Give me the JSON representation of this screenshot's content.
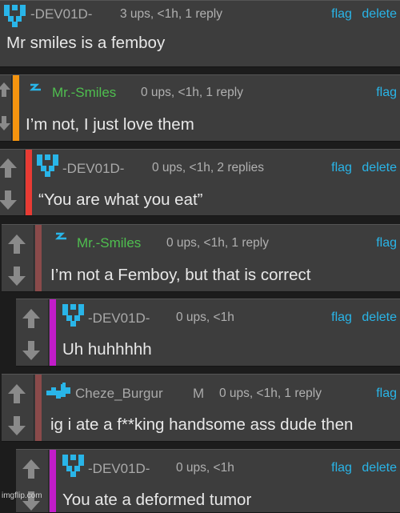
{
  "colors": {
    "accent_link": "#29b5e8",
    "username_default": "#a9a9a9",
    "username_mod": "#4fbf4f",
    "thread_orange": "#f5940f",
    "thread_red": "#e83b34",
    "thread_brown": "#8a4a4a",
    "thread_magenta": "#c21cc9"
  },
  "comments": [
    {
      "avatar": "pixel-logo-icon",
      "username": "-DEV01D-",
      "meta": "3 ups, <1h, 1 reply",
      "actions": [
        "flag",
        "delete"
      ],
      "text": "Mr smiles is a femboy"
    },
    {
      "avatar": "lightning-icon",
      "username": "Mr.-Smiles",
      "meta": "0 ups, <1h, 1 reply",
      "actions": [
        "flag"
      ],
      "text": "I’m not, I just love them"
    },
    {
      "avatar": "pixel-logo-icon",
      "username": "-DEV01D-",
      "meta": "0 ups, <1h, 2 replies",
      "actions": [
        "flag",
        "delete"
      ],
      "text": "“You are what you eat”"
    },
    {
      "avatar": "lightning-icon",
      "username": "Mr.-Smiles",
      "meta": "0 ups, <1h, 1 reply",
      "actions": [
        "flag"
      ],
      "text": "I’m not a Femboy, but that is correct"
    },
    {
      "avatar": "pixel-logo-icon",
      "username": "-DEV01D-",
      "meta": "0 ups, <1h",
      "actions": [
        "flag",
        "delete"
      ],
      "text": "Uh huhhhhh"
    },
    {
      "avatar": "pixel-creature-icon",
      "username": "Cheze_Burgur",
      "badge": "M",
      "meta": "0 ups, <1h, 1 reply",
      "actions": [
        "flag"
      ],
      "text": "ig i ate a f**king handsome ass dude then"
    },
    {
      "avatar": "pixel-logo-icon",
      "username": "-DEV01D-",
      "meta": "0 ups, <1h",
      "actions": [
        "flag",
        "delete"
      ],
      "text": "You ate a deformed tumor"
    }
  ],
  "watermark": "imgflip.com"
}
